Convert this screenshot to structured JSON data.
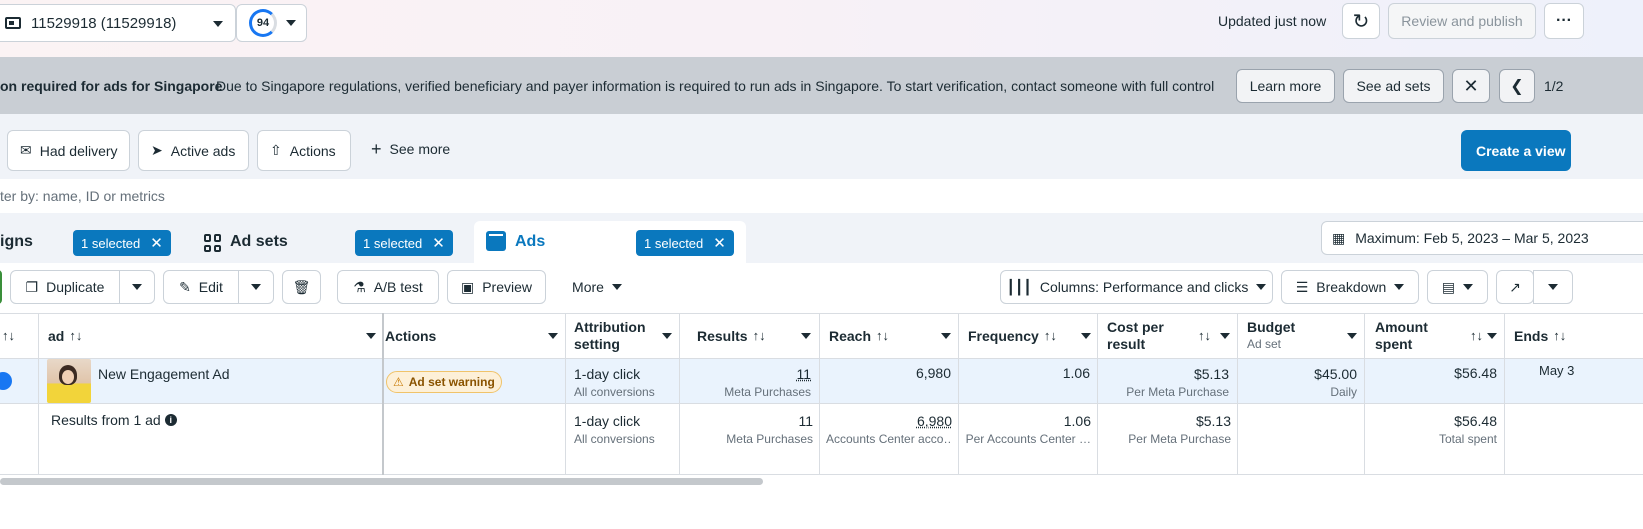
{
  "topbar": {
    "account": "11529918 (11529918)",
    "score": "94",
    "updated": "Updated just now",
    "review_publish": "Review and publish",
    "more": "···"
  },
  "banner": {
    "title": "on required for ads for Singapore",
    "description": "Due to Singapore regulations, verified beneficiary and payer information is required to run ads in Singapore. To start verification, contact someone with full control …",
    "learn_more": "Learn more",
    "see_ad_sets": "See ad sets",
    "pager": "1/2"
  },
  "filters": {
    "chips": [
      "Had delivery",
      "Active ads",
      "Actions"
    ],
    "see_more": "See more",
    "create_view": "Create a view",
    "search_placeholder": "ter by: name, ID or metrics"
  },
  "tabs": {
    "campaigns": {
      "label": "igns",
      "badge": "1 selected"
    },
    "adsets": {
      "label": "Ad sets",
      "badge": "1 selected"
    },
    "ads": {
      "label": "Ads",
      "badge": "1 selected"
    },
    "date_range": "Maximum: Feb 5, 2023 – Mar 5, 2023"
  },
  "toolbar": {
    "duplicate": "Duplicate",
    "edit": "Edit",
    "ab_test": "A/B test",
    "preview": "Preview",
    "more": "More",
    "columns": "Columns: Performance and clicks",
    "breakdown": "Breakdown"
  },
  "table": {
    "headers": {
      "ad": "ad",
      "actions": "Actions",
      "attribution_1": "Attribution",
      "attribution_2": "setting",
      "results": "Results",
      "reach": "Reach",
      "frequency": "Frequency",
      "cost_1": "Cost per",
      "cost_2": "result",
      "budget": "Budget",
      "budget_sub": "Ad set",
      "amount_1": "Amount",
      "amount_2": "spent",
      "ends": "Ends"
    },
    "row": {
      "name": "New Engagement Ad",
      "warning": "Ad set warning",
      "attribution": "1-day click",
      "attribution_sub": "All conversions",
      "results": "11",
      "results_sub": "Meta Purchases",
      "reach": "6,980",
      "frequency": "1.06",
      "cost": "$5.13",
      "cost_sub": "Per Meta Purchase",
      "budget": "$45.00",
      "budget_sub": "Daily",
      "amount": "$56.48",
      "ends": "May 3"
    },
    "summary": {
      "label": "Results from 1 ad",
      "attribution": "1-day click",
      "attribution_sub": "All conversions",
      "results": "11",
      "results_sub": "Meta Purchases",
      "reach": "6,980",
      "reach_sub": "Accounts Center acco…",
      "frequency": "1.06",
      "frequency_sub": "Per Accounts Center …",
      "cost": "$5.13",
      "cost_sub": "Per Meta Purchase",
      "amount": "$56.48",
      "amount_sub": "Total spent"
    }
  }
}
